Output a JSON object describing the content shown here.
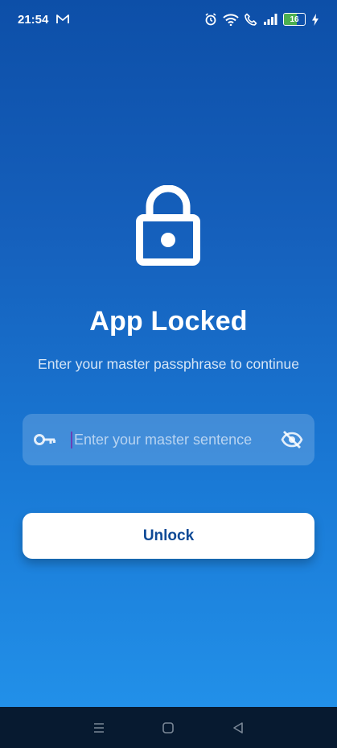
{
  "status_bar": {
    "time": "21:54",
    "battery_level": "16",
    "icons": [
      "gmail-icon",
      "alarm-icon",
      "wifi-icon",
      "call-icon",
      "signal-icon",
      "battery-icon",
      "charging-icon"
    ]
  },
  "lock_screen": {
    "title": "App Locked",
    "subtitle": "Enter your master passphrase to continue",
    "passphrase_input": {
      "placeholder": "Enter your master sentence",
      "value": ""
    },
    "unlock_label": "Unlock"
  },
  "colors": {
    "gradient_top": "#0d4fa8",
    "gradient_bottom": "#2394ec",
    "button_text": "#0f4a96",
    "nav_bar": "#071a30"
  },
  "nav_bar": {
    "icons": [
      "menu-icon",
      "home-icon",
      "back-icon"
    ]
  }
}
